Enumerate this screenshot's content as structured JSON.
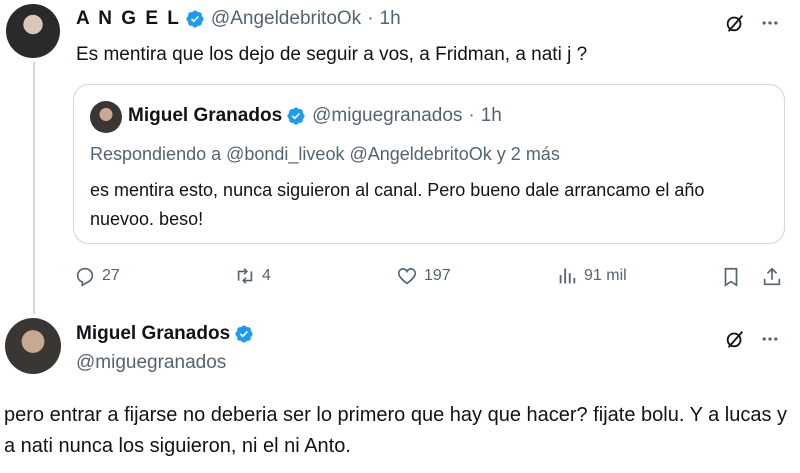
{
  "main_tweet": {
    "display_name": "A N G E L",
    "handle": "@AngeldebritoOk",
    "time": "1h",
    "text": "Es mentira que los dejo de seguir a vos, a Fridman, a nati j ?"
  },
  "quote": {
    "display_name": "Miguel Granados",
    "handle": "@miguegranados",
    "time": "1h",
    "reply_to": "Respondiendo a @bondi_liveok @AngeldebritoOk y 2 más",
    "text": "es mentira esto, nunca siguieron al canal. Pero bueno dale arrancamo el año nuevoo. beso!"
  },
  "actions": {
    "replies": "27",
    "reposts": "4",
    "likes": "197",
    "views": "91 mil"
  },
  "reply_tweet": {
    "display_name": "Miguel Granados",
    "handle": "@miguegranados",
    "text": "pero entrar a fijarse no deberia ser lo primero que hay que hacer? fijate bolu. Y a lucas y a nati nunca los siguieron, ni el ni Anto."
  },
  "colors": {
    "verified": "#1d9bf0",
    "muted": "#536471",
    "border": "#cfd9de",
    "text": "#0f1419"
  },
  "icons": [
    "verified-badge-icon",
    "grok-icon",
    "more-icon",
    "reply-icon",
    "repost-icon",
    "like-icon",
    "views-icon",
    "bookmark-icon",
    "share-icon"
  ]
}
